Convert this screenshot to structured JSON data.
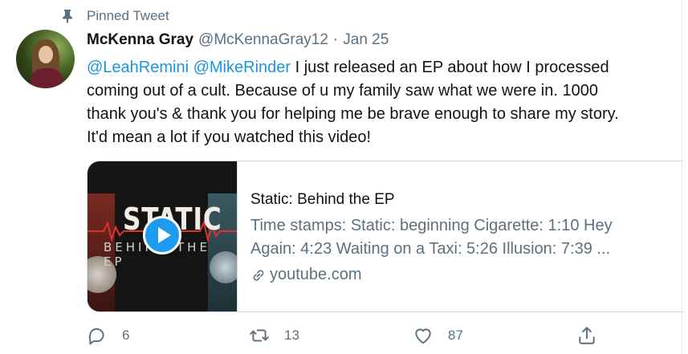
{
  "pinned": {
    "label": "Pinned Tweet",
    "icon": "pin-icon"
  },
  "author": {
    "name": "McKenna Gray",
    "handle": "@McKennaGray12",
    "separator": "·",
    "date": "Jan 25"
  },
  "tweet": {
    "mentions": [
      "@LeahRemini",
      "@MikeRinder"
    ],
    "line1_text": " I just released an EP about how I processed",
    "line2": "coming out of a cult. Because of u my family saw what we were in. 1000",
    "line3": "thank you's & thank you for helping me be brave enough to share my story.",
    "line4": "It'd mean a lot if you watched this video!"
  },
  "card": {
    "thumbnail_title": "STATIC",
    "thumbnail_subtitle": "BEHIND THE EP",
    "title": "Static: Behind the EP",
    "description_line1": "Time stamps: Static: beginning Cigarette: 1:10 Hey",
    "description_line2": "Again: 4:23 Waiting on a Taxi: 5:26 Illusion: 7:39 ...",
    "domain": "youtube.com",
    "play_icon": "play-icon",
    "link_icon": "link-icon"
  },
  "actions": {
    "reply_count": "6",
    "retweet_count": "13",
    "like_count": "87"
  },
  "colors": {
    "accent": "#1b95e0",
    "muted": "#5b7083",
    "text": "#0f1419",
    "border": "#cfd9de"
  }
}
